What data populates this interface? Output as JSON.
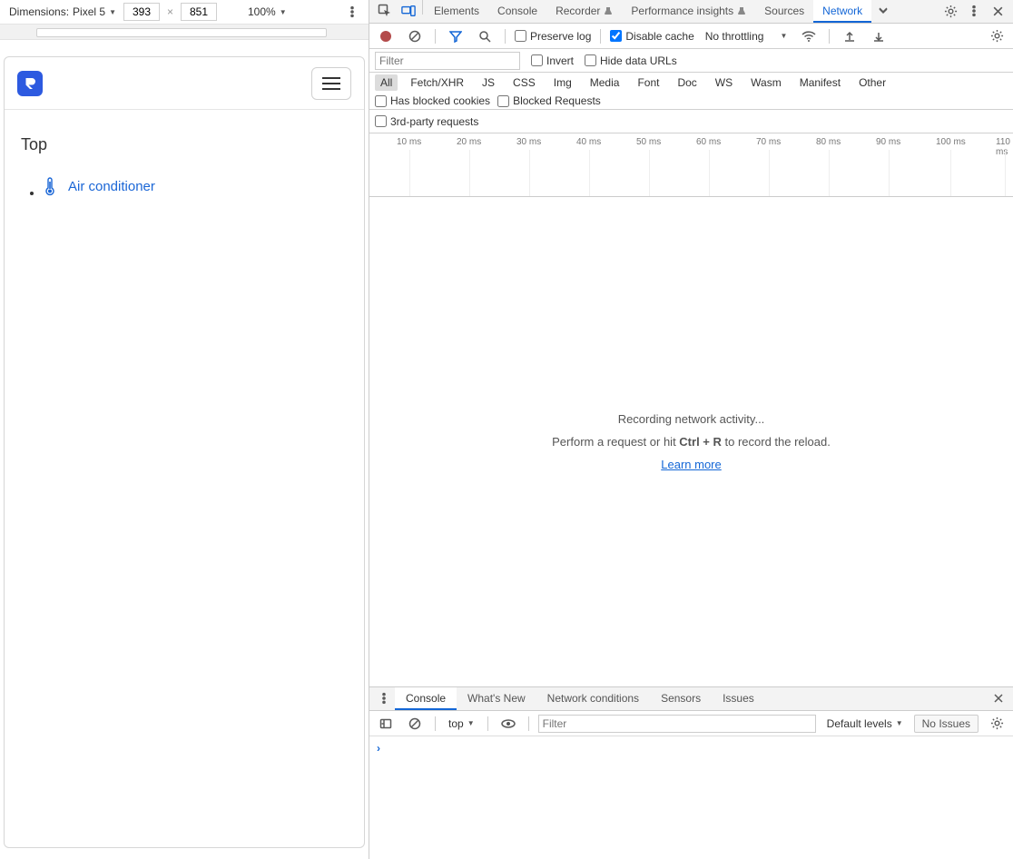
{
  "device_toolbar": {
    "dimensions_label": "Dimensions:",
    "device_name": "Pixel 5",
    "width": "393",
    "height": "851",
    "times": "×",
    "zoom": "100%"
  },
  "app": {
    "title": "Top",
    "items": [
      {
        "label": "Air conditioner"
      }
    ]
  },
  "devtools": {
    "tabs": [
      "Elements",
      "Console",
      "Recorder",
      "Performance insights",
      "Sources",
      "Network"
    ],
    "active_tab": "Network",
    "network_toolbar": {
      "preserve_log": "Preserve log",
      "disable_cache": "Disable cache",
      "throttling": "No throttling"
    },
    "filter_row": {
      "filter_placeholder": "Filter",
      "invert": "Invert",
      "hide_data_urls": "Hide data URLs"
    },
    "types": [
      "All",
      "Fetch/XHR",
      "JS",
      "CSS",
      "Img",
      "Media",
      "Font",
      "Doc",
      "WS",
      "Wasm",
      "Manifest",
      "Other"
    ],
    "type_checks": {
      "blocked_cookies": "Has blocked cookies",
      "blocked_requests": "Blocked Requests",
      "third_party": "3rd-party requests"
    },
    "timeline_ticks": [
      "10 ms",
      "20 ms",
      "30 ms",
      "40 ms",
      "50 ms",
      "60 ms",
      "70 ms",
      "80 ms",
      "90 ms",
      "100 ms",
      "110 ms"
    ],
    "network_empty": {
      "recording": "Recording network activity...",
      "hint_pre": "Perform a request or hit ",
      "hint_key": "Ctrl + R",
      "hint_post": " to record the reload.",
      "learn_more": "Learn more"
    },
    "drawer": {
      "tabs": [
        "Console",
        "What's New",
        "Network conditions",
        "Sensors",
        "Issues"
      ],
      "active_tab": "Console",
      "context": "top",
      "filter_placeholder": "Filter",
      "levels": "Default levels",
      "no_issues": "No Issues"
    }
  }
}
